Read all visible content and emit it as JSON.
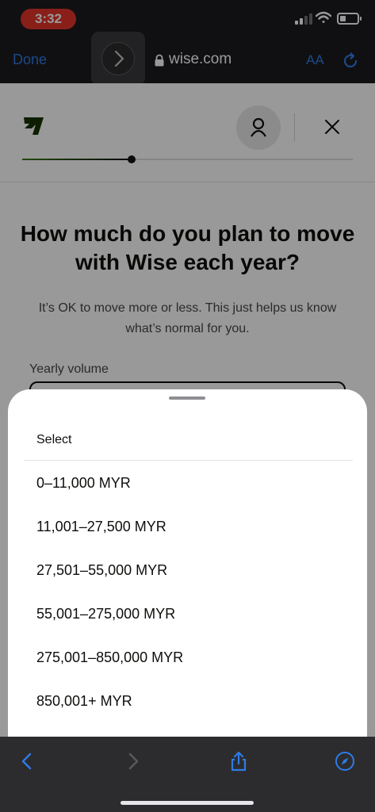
{
  "status_bar": {
    "time": "3:32"
  },
  "browser": {
    "done_label": "Done",
    "url": "wise.com",
    "aa_label": "AA"
  },
  "page": {
    "heading": "How much do you plan to move with Wise each year?",
    "subtext": "It’s OK to move more or less. This just helps us know what’s normal for you.",
    "field_label": "Yearly volume",
    "progress": 0.33
  },
  "sheet": {
    "title": "Select",
    "options": [
      "0–11,000 MYR",
      "11,001–27,500 MYR",
      "27,501–55,000 MYR",
      "55,001–275,000 MYR",
      "275,001–850,000 MYR",
      "850,001+ MYR"
    ]
  },
  "colors": {
    "accent_blue": "#2f7be5",
    "brand_green": "#3b7a1a",
    "time_pill": "#e5352b"
  },
  "icons": [
    "signal-icon",
    "wifi-icon",
    "battery-icon",
    "lock-icon",
    "reload-icon",
    "forward-icon",
    "wise-logo-icon",
    "profile-icon",
    "close-icon",
    "back-icon",
    "share-icon",
    "compass-icon"
  ]
}
